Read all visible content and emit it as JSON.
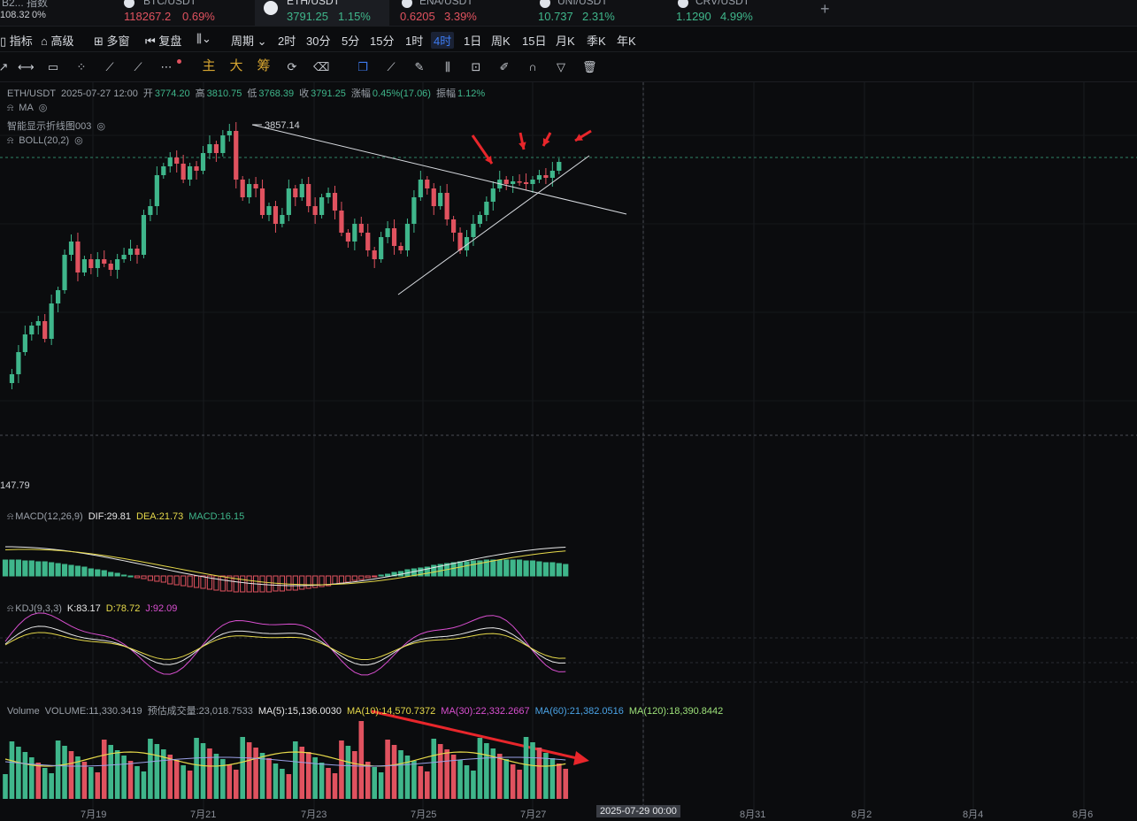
{
  "ticker": {
    "index_label": "B2... 指数",
    "index_value": "108.32",
    "index_change": "0%",
    "items": [
      {
        "symbol": "BTC/USDT",
        "price": "118267.2",
        "change": "0.69%",
        "dir": "down"
      },
      {
        "symbol": "ETH/USDT",
        "price": "3791.25",
        "change": "1.15%",
        "dir": "up",
        "active": true
      },
      {
        "symbol": "ENA/USDT",
        "price": "0.6205",
        "change": "3.39%",
        "dir": "down"
      },
      {
        "symbol": "UNI/USDT",
        "price": "10.737",
        "change": "2.31%",
        "dir": "up"
      },
      {
        "symbol": "CRV/USDT",
        "price": "1.1290",
        "change": "4.99%",
        "dir": "up"
      }
    ],
    "add_label": "+"
  },
  "toolbar": {
    "indicators": "指标",
    "advanced": "高级",
    "multi_window": "多窗",
    "replay": "复盘",
    "period": "周期",
    "intervals": [
      "2时",
      "30分",
      "5分",
      "15分",
      "1时",
      "4时",
      "1日",
      "周K",
      "15日",
      "月K",
      "季K",
      "年K"
    ],
    "selected_interval": "4时"
  },
  "drawing_tools": {
    "main_label": "主",
    "big_label": "大",
    "chips_label": "筹"
  },
  "legend": {
    "symbol": "ETH/USDT",
    "datetime": "2025-07-27 12:00",
    "open_label": "开",
    "open": "3774.20",
    "high_label": "高",
    "high": "3810.75",
    "low_label": "低",
    "low": "3768.39",
    "close_label": "收",
    "close": "3791.25",
    "change_label": "涨幅",
    "change": "0.45%(17.06)",
    "amplitude_label": "振幅",
    "amplitude": "1.12%",
    "ma": "MA",
    "smart_line": "智能显示折线图003",
    "boll": "BOLL(20,2)",
    "high_marker": "3857.14",
    "low_axis_value": "147.79"
  },
  "macd": {
    "name": "MACD(12,26,9)",
    "dif": "DIF:29.81",
    "dea": "DEA:21.73",
    "macd": "MACD:16.15"
  },
  "kdj": {
    "name": "KDJ(9,3,3)",
    "k": "K:83.17",
    "d": "D:78.72",
    "j": "J:92.09"
  },
  "volume": {
    "name": "Volume",
    "volume": "VOLUME:11,330.3419",
    "forecast": "预估成交量:23,018.7533",
    "ma5": "MA(5):15,136.0030",
    "ma10": "MA(10):14,570.7372",
    "ma30": "MA(30):22,332.2667",
    "ma60": "MA(60):21,382.0516",
    "ma120": "MA(120):18,390.8442"
  },
  "x_axis": {
    "labels": [
      "7月19",
      "7月21",
      "7月23",
      "7月25",
      "7月27",
      "8月31",
      "8月2",
      "8月4",
      "8月6"
    ],
    "crosshair_label": "2025-07-29 00:00"
  },
  "colors": {
    "up": "#3fb68b",
    "down": "#e0525f",
    "accent": "#3d7bf0",
    "arrow": "#e8262b"
  }
}
